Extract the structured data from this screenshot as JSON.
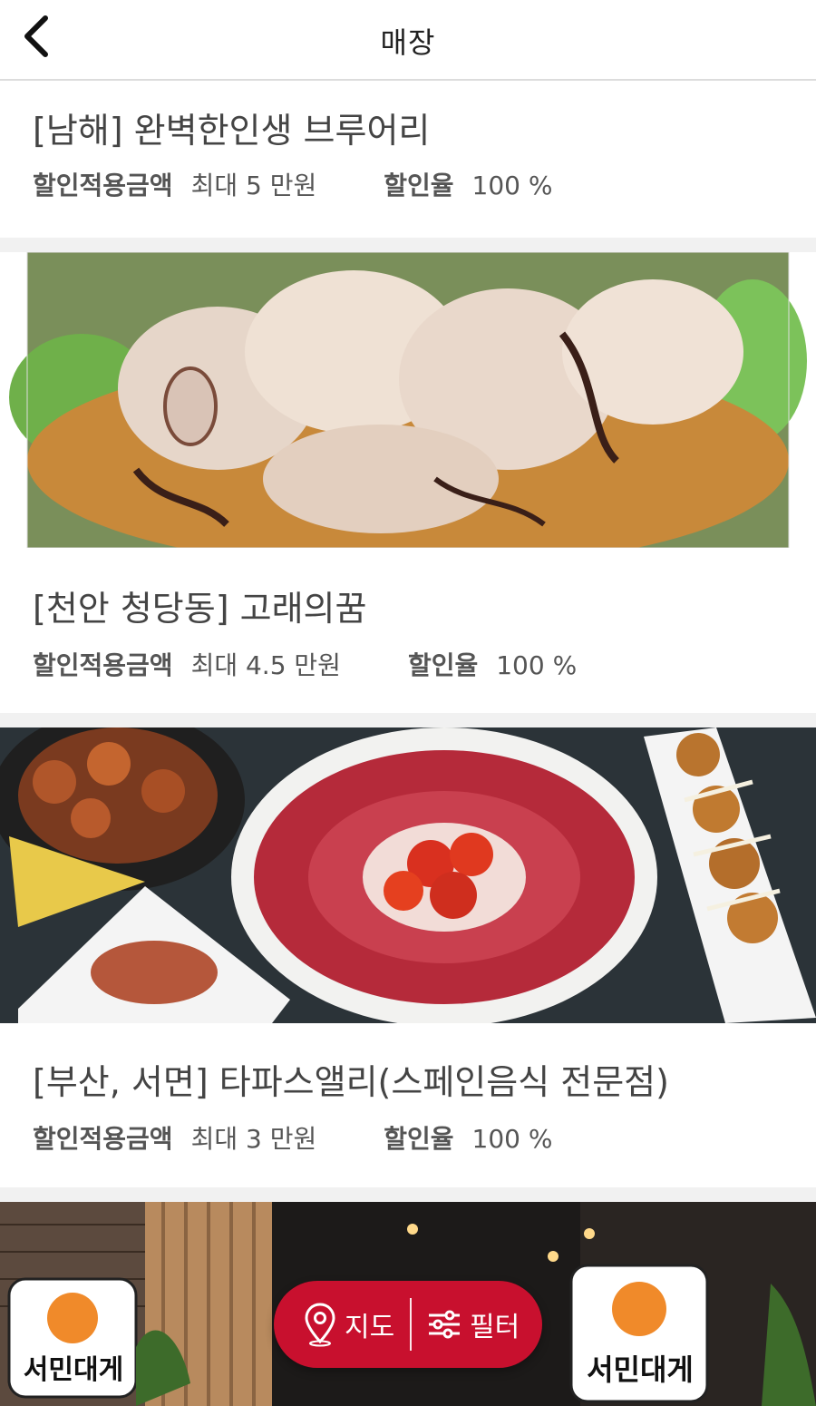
{
  "header": {
    "title": "매장",
    "back_icon": "chevron-left-icon"
  },
  "labels": {
    "discount_amount": "할인적용금액",
    "discount_rate": "할인율"
  },
  "stores": [
    {
      "name": "[남해] 완벽한인생 브루어리",
      "amount": "최대 5 만원",
      "rate": "100 %"
    },
    {
      "name": "[천안 청당동] 고래의꿈",
      "amount": "최대 4.5 만원",
      "rate": "100 %"
    },
    {
      "name": "[부산, 서면] 타파스앨리(스페인음식 전문점)",
      "amount": "최대 3 만원",
      "rate": "100 %"
    },
    {
      "name": "",
      "amount": "",
      "rate": "",
      "sign_text": "서민대게"
    }
  ],
  "fab": {
    "map_label": "지도",
    "filter_label": "필터",
    "map_icon": "map-pin-icon",
    "filter_icon": "sliders-icon"
  },
  "colors": {
    "accent": "#c8102e",
    "separator": "#f1f1f1"
  }
}
